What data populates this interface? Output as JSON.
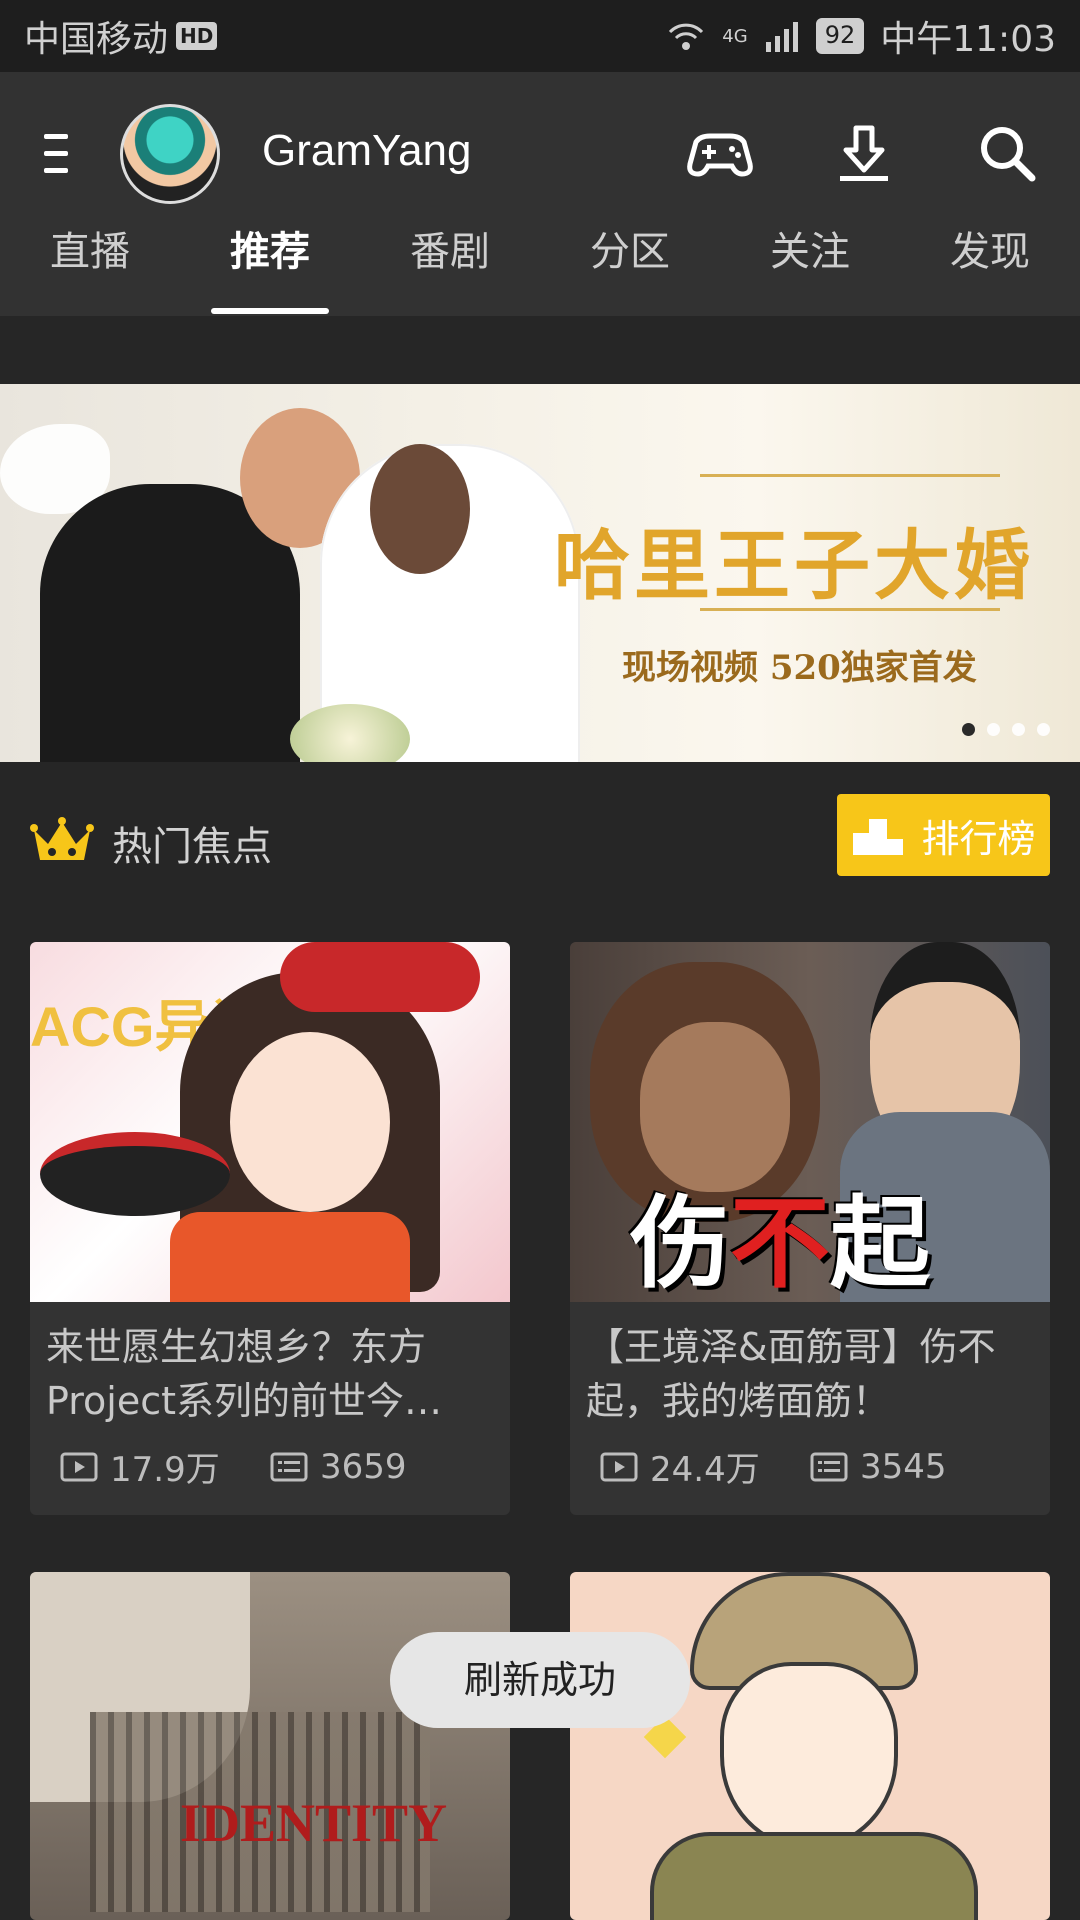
{
  "status_bar": {
    "carrier": "中国移动",
    "hd_badge": "HD",
    "network": "4G",
    "battery": "92",
    "time": "中午11:03"
  },
  "header": {
    "username": "GramYang",
    "tabs": [
      {
        "label": "直播"
      },
      {
        "label": "推荐",
        "active": true
      },
      {
        "label": "番剧"
      },
      {
        "label": "分区"
      },
      {
        "label": "关注"
      },
      {
        "label": "发现"
      }
    ],
    "icons": [
      "menu-icon",
      "game-controller-icon",
      "download-icon",
      "search-icon"
    ]
  },
  "banner": {
    "title": "哈里王子大婚",
    "subtitle": "现场视频  520独家首发",
    "page_count": 4,
    "current_page": 1
  },
  "section": {
    "title": "热门焦点",
    "ranking_label": "排行榜",
    "accent_color": "#f7c619"
  },
  "cards": [
    {
      "title": "来世愿生幻想乡？东方Project系列的前世今…",
      "plays": "17.9万",
      "comments": "3659",
      "thumb_text": "ACG异闻录"
    },
    {
      "title": "【王境泽&面筋哥】伤不起，我的烤面筋！",
      "plays": "24.4万",
      "comments": "3545",
      "thumb_text_a": "伤",
      "thumb_text_b": "不",
      "thumb_text_c": "起"
    },
    {
      "thumb_text": "IDENTITY"
    },
    {}
  ],
  "toast": "刷新成功"
}
